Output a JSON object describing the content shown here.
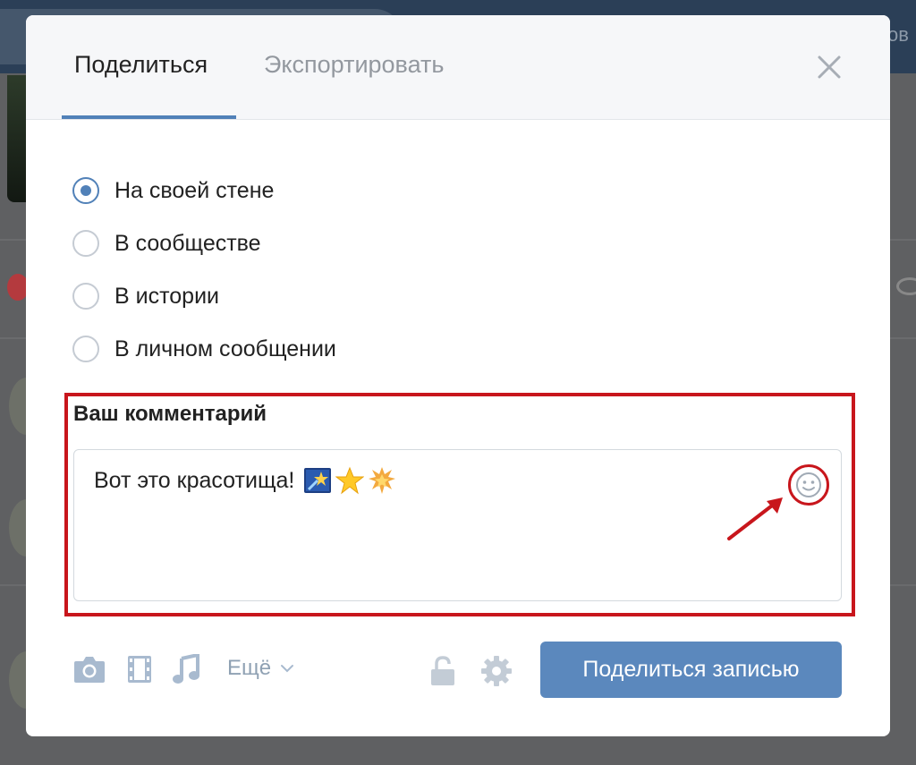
{
  "background": {
    "topbar_text": "ов"
  },
  "modal": {
    "tabs": [
      {
        "label": "Поделиться",
        "active": true
      },
      {
        "label": "Экспортировать",
        "active": false
      }
    ],
    "close_icon": "close-icon",
    "share_options": [
      {
        "label": "На своей стене",
        "checked": true
      },
      {
        "label": "В сообществе",
        "checked": false
      },
      {
        "label": "В истории",
        "checked": false
      },
      {
        "label": "В личном сообщении",
        "checked": false
      }
    ],
    "comment": {
      "title": "Ваш комментарий",
      "value": "Вот это красотища!",
      "emojis": [
        "shooting-star-emoji",
        "star-emoji",
        "glowing-star-emoji"
      ],
      "emoji_button_icon": "smile-icon"
    },
    "toolbar": {
      "icons": [
        "camera-icon",
        "film-icon",
        "music-icon"
      ],
      "more_label": "Ещё",
      "privacy_icon": "lock-icon",
      "settings_icon": "gear-icon",
      "submit_label": "Поделиться записью"
    }
  },
  "colors": {
    "accent": "#5181b8",
    "button": "#5b88bd",
    "highlight": "#c8161c",
    "overlay": "#5f6062"
  }
}
